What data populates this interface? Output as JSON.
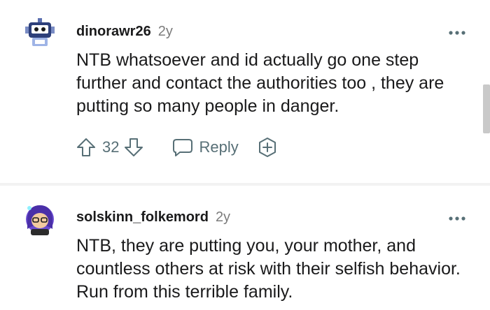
{
  "comments": [
    {
      "username": "dinorawr26",
      "age": "2y",
      "avatar": "robot-snoo-avatar",
      "body": "NTB whatsoever and id actually go one step further and contact the authorities too , they are putting so many people in danger.",
      "score": "32",
      "reply_label": "Reply"
    },
    {
      "username": "solskinn_folkemord",
      "age": "2y",
      "avatar": "blue-hair-snoo-avatar",
      "body": "NTB, they are putting you, your mother, and countless others at risk with their selfish behavior. Run from this terrible family."
    }
  ],
  "icons": {
    "more": "more-horizontal-icon",
    "upvote": "upvote-arrow-icon",
    "downvote": "downvote-arrow-icon",
    "reply": "speech-bubble-icon",
    "award": "award-plus-icon"
  },
  "colors": {
    "text": "#1a1a1b",
    "meta": "#7c7c7c",
    "action": "#576f76",
    "divider": "#f2f2f2"
  }
}
